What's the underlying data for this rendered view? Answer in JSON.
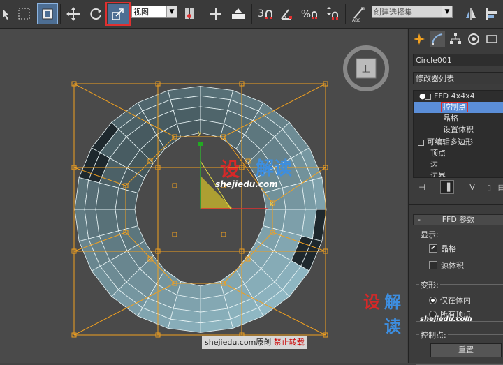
{
  "toolbar": {
    "view_dropdown": "视图",
    "snap_3": "3",
    "selection_set_placeholder": "创建选择集"
  },
  "viewport": {
    "watermark_brand_a": "设",
    "watermark_brand_b": "解读",
    "watermark_url": "shejiedu.com",
    "footer_site": "shejiedu.com原创",
    "footer_warning": "禁止转载",
    "bottom_brand_a": "设",
    "bottom_brand_b": "解读",
    "bottom_url": "shejiedu.com",
    "gizmo_x": "x",
    "gizmo_y": "y",
    "viewcube_face": "上"
  },
  "panel": {
    "object_name": "Circle001",
    "modifier_list": "修改器列表",
    "stack": [
      {
        "label": "FFD 4x4x4",
        "indent": 0
      },
      {
        "label": "控制点",
        "indent": 1,
        "selected": true
      },
      {
        "label": "晶格",
        "indent": 1
      },
      {
        "label": "设置体积",
        "indent": 1
      },
      {
        "label": "可编辑多边形",
        "indent": 0
      },
      {
        "label": "顶点",
        "indent": 1
      },
      {
        "label": "边",
        "indent": 1
      },
      {
        "label": "边界",
        "indent": 1
      }
    ],
    "rollout_title": "FFD 参数",
    "display_group": "显示:",
    "lattice_label": "晶格",
    "source_volume_label": "源体积",
    "deform_group": "变形:",
    "only_in_volume": "仅在体内",
    "all_vertices": "所有顶点",
    "control_points_group": "控制点:",
    "reset_button": "重置"
  }
}
